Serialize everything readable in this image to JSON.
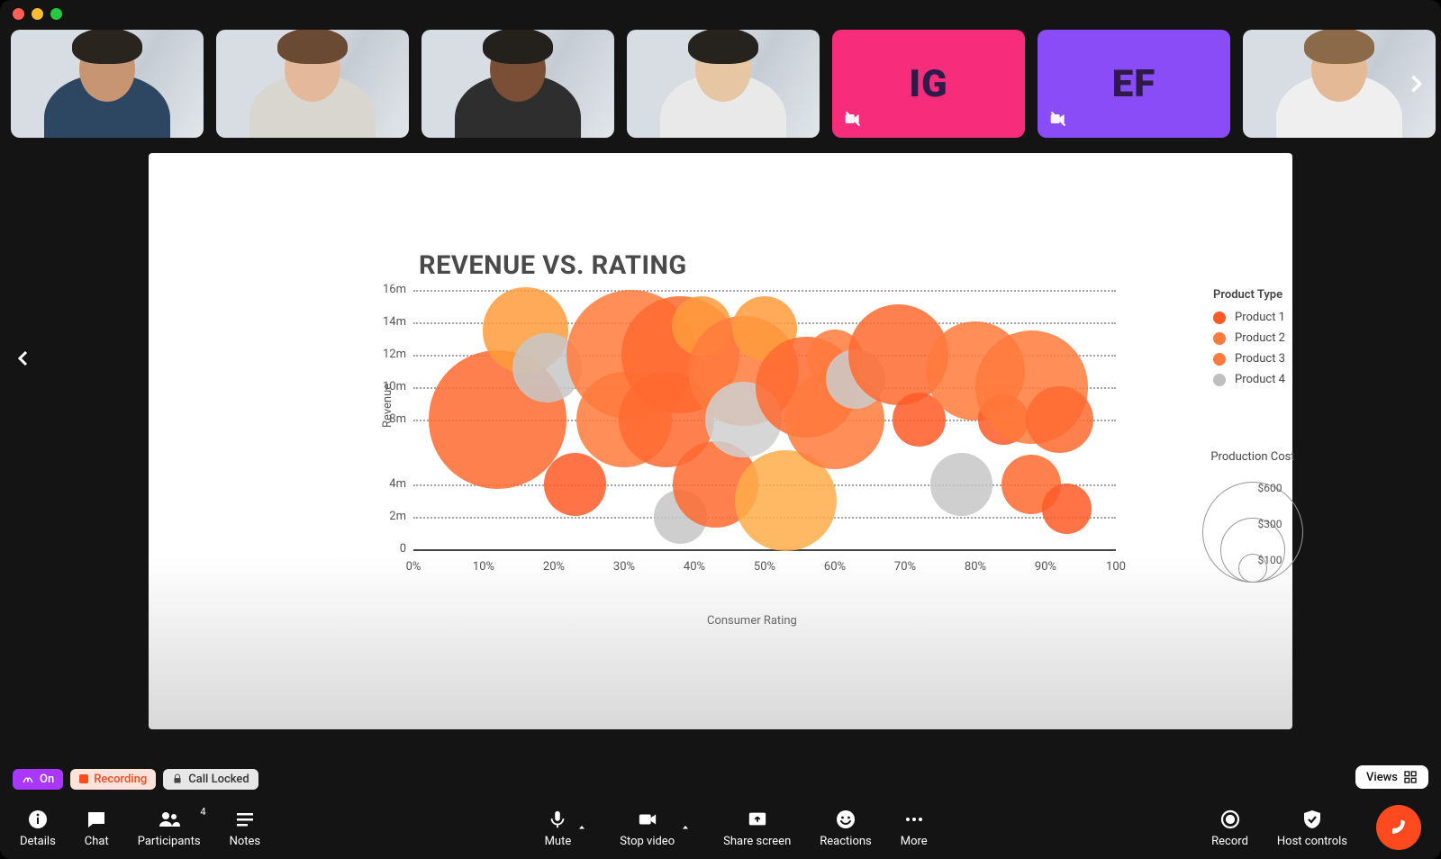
{
  "participants": [
    {
      "type": "video",
      "desc": "man-1"
    },
    {
      "type": "video",
      "desc": "woman-1"
    },
    {
      "type": "video",
      "desc": "woman-2"
    },
    {
      "type": "video",
      "desc": "man-2"
    },
    {
      "type": "avatar",
      "initials": "IG",
      "color": "pink"
    },
    {
      "type": "avatar",
      "initials": "EF",
      "color": "purple"
    },
    {
      "type": "video",
      "desc": "man-3"
    },
    {
      "type": "video",
      "desc": "woman-3"
    }
  ],
  "status": {
    "ai": "On",
    "recording": "Recording",
    "lock": "Call Locked",
    "views": "Views"
  },
  "toolbar": {
    "details": "Details",
    "chat": "Chat",
    "participants": "Participants",
    "participants_count": "4",
    "notes": "Notes",
    "mute": "Mute",
    "stop_video": "Stop video",
    "share": "Share screen",
    "reactions": "Reactions",
    "more": "More",
    "record": "Record",
    "host": "Host controls"
  },
  "chart_data": {
    "type": "bubble",
    "title": "REVENUE VS. RATING",
    "xlabel": "Consumer Rating",
    "ylabel": "Revenue",
    "xlim": [
      0,
      100
    ],
    "ylim": [
      0,
      16
    ],
    "xticks": [
      "0%",
      "10%",
      "20%",
      "30%",
      "40%",
      "50%",
      "60%",
      "70%",
      "80%",
      "90%",
      "100"
    ],
    "yticks": [
      "0",
      "2m",
      "4m",
      "8m",
      "10m",
      "12m",
      "14m",
      "16m"
    ],
    "legend_title": "Product Type",
    "series_names": [
      "Product 1",
      "Product 2",
      "Product 3",
      "Product 4"
    ],
    "series_colors": [
      "#ff5a26",
      "#ff7a3c",
      "#ff7a3c",
      "#bfbfbf"
    ],
    "size_legend_title": "Production Cost",
    "size_legend": [
      {
        "label": "$600",
        "r": 56
      },
      {
        "label": "$300",
        "r": 36
      },
      {
        "label": "$100",
        "r": 16
      }
    ],
    "points": [
      {
        "x": 12,
        "y": 8,
        "size": 600,
        "product": 2,
        "color": "#ff6a30"
      },
      {
        "x": 16,
        "y": 13.5,
        "size": 200,
        "product": 3,
        "color": "#ff9b3c"
      },
      {
        "x": 19,
        "y": 11.2,
        "size": 120,
        "product": 4,
        "color": "#c7c7c7"
      },
      {
        "x": 23,
        "y": 4,
        "size": 90,
        "product": 1,
        "color": "#ff5a26"
      },
      {
        "x": 30,
        "y": 8,
        "size": 260,
        "product": 2,
        "color": "#ff7a3c"
      },
      {
        "x": 31,
        "y": 12,
        "size": 520,
        "product": 2,
        "color": "#ff7a3c"
      },
      {
        "x": 38,
        "y": 12,
        "size": 420,
        "product": 1,
        "color": "#ff6a30"
      },
      {
        "x": 36,
        "y": 8,
        "size": 260,
        "product": 1,
        "color": "#ff6a30"
      },
      {
        "x": 38,
        "y": 2,
        "size": 60,
        "product": 4,
        "color": "#c5c5c5"
      },
      {
        "x": 41,
        "y": 13.8,
        "size": 80,
        "product": 3,
        "color": "#ff9b3c"
      },
      {
        "x": 43,
        "y": 4,
        "size": 200,
        "product": 1,
        "color": "#ff6a30"
      },
      {
        "x": 47,
        "y": 11,
        "size": 360,
        "product": 2,
        "color": "#ff7a3c"
      },
      {
        "x": 47,
        "y": 8,
        "size": 150,
        "product": 4,
        "color": "#cfcfcf"
      },
      {
        "x": 50,
        "y": 13.6,
        "size": 100,
        "product": 3,
        "color": "#ff9b3c"
      },
      {
        "x": 53,
        "y": 3,
        "size": 300,
        "product": 3,
        "color": "#ffad4a"
      },
      {
        "x": 56,
        "y": 10,
        "size": 300,
        "product": 1,
        "color": "#ff6a30"
      },
      {
        "x": 60,
        "y": 8,
        "size": 280,
        "product": 2,
        "color": "#ff7a3c"
      },
      {
        "x": 60,
        "y": 11.8,
        "size": 70,
        "product": 2,
        "color": "#ff7a3c"
      },
      {
        "x": 63,
        "y": 10.5,
        "size": 80,
        "product": 4,
        "color": "#cbcbcb"
      },
      {
        "x": 69,
        "y": 12,
        "size": 290,
        "product": 1,
        "color": "#ff6a30"
      },
      {
        "x": 72,
        "y": 8,
        "size": 60,
        "product": 1,
        "color": "#ff5a26"
      },
      {
        "x": 78,
        "y": 4,
        "size": 90,
        "product": 4,
        "color": "#c7c7c7"
      },
      {
        "x": 80,
        "y": 11,
        "size": 280,
        "product": 2,
        "color": "#ff7a3c"
      },
      {
        "x": 84,
        "y": 8,
        "size": 50,
        "product": 1,
        "color": "#ff5a26"
      },
      {
        "x": 88,
        "y": 10,
        "size": 380,
        "product": 2,
        "color": "#ff7a3c"
      },
      {
        "x": 88,
        "y": 4,
        "size": 80,
        "product": 1,
        "color": "#ff6a30"
      },
      {
        "x": 92,
        "y": 8,
        "size": 110,
        "product": 1,
        "color": "#ff6a30"
      },
      {
        "x": 93,
        "y": 2.5,
        "size": 50,
        "product": 1,
        "color": "#ff5a26"
      }
    ]
  }
}
